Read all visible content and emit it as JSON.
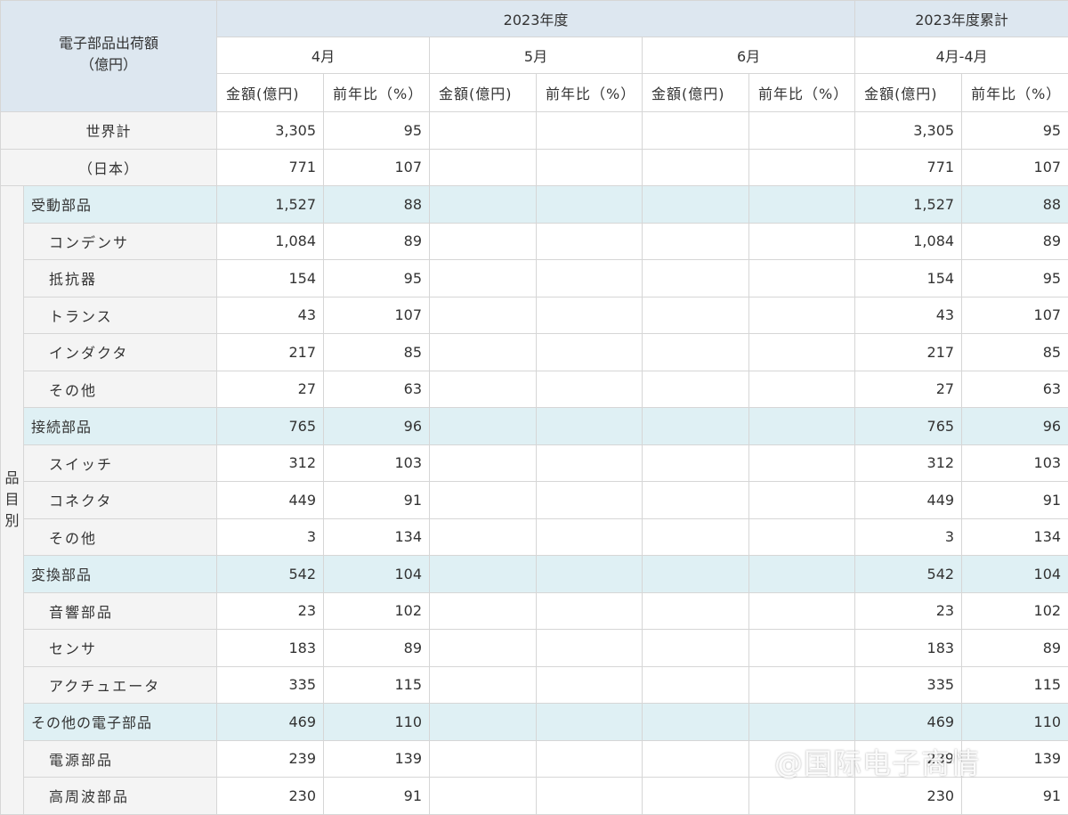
{
  "corner": {
    "line1": "電子部品出荷額",
    "line2": "（億円）"
  },
  "period_main": "2023年度",
  "period_cum": "2023年度累計",
  "months": [
    "4月",
    "5月",
    "6月"
  ],
  "cum_months": "4月-4月",
  "col_amount": "金額(億円)",
  "col_yoy": "前年比（%）",
  "side_label": [
    "品",
    "目",
    "別"
  ],
  "totals": [
    {
      "label": "世界計",
      "amt": "3,305",
      "yoy": "95",
      "cum_amt": "3,305",
      "cum_yoy": "95"
    },
    {
      "label": "（日本）",
      "amt": "771",
      "yoy": "107",
      "cum_amt": "771",
      "cum_yoy": "107"
    }
  ],
  "rows": [
    {
      "kind": "cat",
      "label": "受動部品",
      "amt": "1,527",
      "yoy": "88",
      "cum_amt": "1,527",
      "cum_yoy": "88"
    },
    {
      "kind": "sub",
      "label": "コンデンサ",
      "amt": "1,084",
      "yoy": "89",
      "cum_amt": "1,084",
      "cum_yoy": "89"
    },
    {
      "kind": "sub",
      "label": "抵抗器",
      "amt": "154",
      "yoy": "95",
      "cum_amt": "154",
      "cum_yoy": "95"
    },
    {
      "kind": "sub",
      "label": "トランス",
      "amt": "43",
      "yoy": "107",
      "cum_amt": "43",
      "cum_yoy": "107"
    },
    {
      "kind": "sub",
      "label": "インダクタ",
      "amt": "217",
      "yoy": "85",
      "cum_amt": "217",
      "cum_yoy": "85"
    },
    {
      "kind": "sub",
      "label": "その他",
      "amt": "27",
      "yoy": "63",
      "cum_amt": "27",
      "cum_yoy": "63"
    },
    {
      "kind": "cat",
      "label": "接続部品",
      "amt": "765",
      "yoy": "96",
      "cum_amt": "765",
      "cum_yoy": "96"
    },
    {
      "kind": "sub",
      "label": "スイッチ",
      "amt": "312",
      "yoy": "103",
      "cum_amt": "312",
      "cum_yoy": "103"
    },
    {
      "kind": "sub",
      "label": "コネクタ",
      "amt": "449",
      "yoy": "91",
      "cum_amt": "449",
      "cum_yoy": "91"
    },
    {
      "kind": "sub",
      "label": "その他",
      "amt": "3",
      "yoy": "134",
      "cum_amt": "3",
      "cum_yoy": "134"
    },
    {
      "kind": "cat",
      "label": "変換部品",
      "amt": "542",
      "yoy": "104",
      "cum_amt": "542",
      "cum_yoy": "104"
    },
    {
      "kind": "sub",
      "label": "音響部品",
      "amt": "23",
      "yoy": "102",
      "cum_amt": "23",
      "cum_yoy": "102"
    },
    {
      "kind": "sub",
      "label": "センサ",
      "amt": "183",
      "yoy": "89",
      "cum_amt": "183",
      "cum_yoy": "89"
    },
    {
      "kind": "sub",
      "label": "アクチュエータ",
      "amt": "335",
      "yoy": "115",
      "cum_amt": "335",
      "cum_yoy": "115"
    },
    {
      "kind": "cat",
      "label": "その他の電子部品",
      "amt": "469",
      "yoy": "110",
      "cum_amt": "469",
      "cum_yoy": "110"
    },
    {
      "kind": "sub",
      "label": "電源部品",
      "amt": "239",
      "yoy": "139",
      "cum_amt": "239",
      "cum_yoy": "139"
    },
    {
      "kind": "sub",
      "label": "高周波部品",
      "amt": "230",
      "yoy": "91",
      "cum_amt": "230",
      "cum_yoy": "91"
    }
  ],
  "watermark": "@国际电子商情"
}
